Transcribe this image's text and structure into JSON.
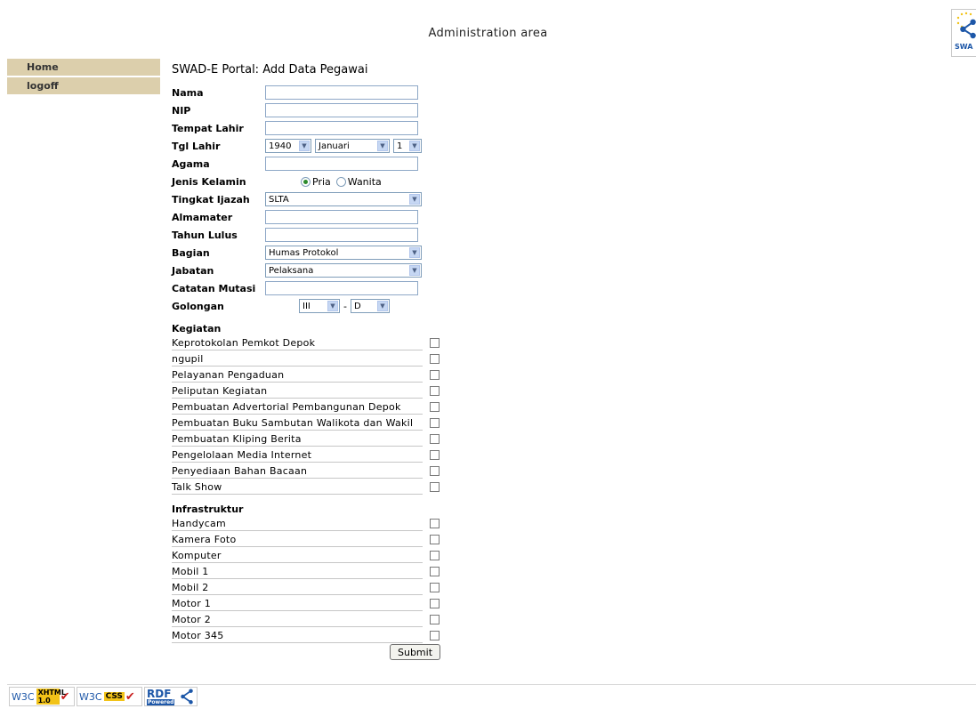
{
  "header": {
    "title": "Administration area",
    "logo_text": "SWA"
  },
  "sidebar": {
    "items": [
      {
        "label": "Home"
      },
      {
        "label": "logoff"
      }
    ]
  },
  "page": {
    "title": "SWAD-E Portal: Add Data Pegawai"
  },
  "form": {
    "nama_label": "Nama",
    "nip_label": "NIP",
    "tempat_lahir_label": "Tempat Lahir",
    "tgl_lahir_label": "Tgl Lahir",
    "tgl_year": "1940",
    "tgl_month": "Januari",
    "tgl_day": "1",
    "agama_label": "Agama",
    "jenis_kelamin_label": "Jenis Kelamin",
    "gender_options": [
      "Pria",
      "Wanita"
    ],
    "gender_selected": "Pria",
    "tingkat_ijazah_label": "Tingkat Ijazah",
    "tingkat_ijazah_value": "SLTA",
    "almamater_label": "Almamater",
    "tahun_lulus_label": "Tahun Lulus",
    "bagian_label": "Bagian",
    "bagian_value": "Humas Protokol",
    "jabatan_label": "Jabatan",
    "jabatan_value": "Pelaksana",
    "catatan_mutasi_label": "Catatan Mutasi",
    "golongan_label": "Golongan",
    "golongan_value": "III",
    "golongan_separator": "-",
    "golongan_ruang": "D",
    "submit_label": "Submit"
  },
  "kegiatan": {
    "heading": "Kegiatan",
    "items": [
      "Keprotokolan Pemkot Depok",
      "ngupil",
      "Pelayanan Pengaduan",
      "Peliputan Kegiatan",
      "Pembuatan Advertorial Pembangunan Depok",
      "Pembuatan Buku Sambutan Walikota dan Wakil",
      "Pembuatan Kliping Berita",
      "Pengelolaan Media Internet",
      "Penyediaan Bahan Bacaan",
      "Talk Show"
    ]
  },
  "infrastruktur": {
    "heading": "Infrastruktur",
    "items": [
      "Handycam",
      "Kamera Foto",
      "Komputer",
      "Mobil 1",
      "Mobil 2",
      "Motor 1",
      "Motor 2",
      "Motor 345"
    ]
  },
  "footer": {
    "badges": [
      {
        "w3c": "W3C",
        "label": "XHTML 1.0"
      },
      {
        "w3c": "W3C",
        "label": "CSS"
      },
      {
        "label": "RDF",
        "sub": "Powered"
      }
    ]
  }
}
